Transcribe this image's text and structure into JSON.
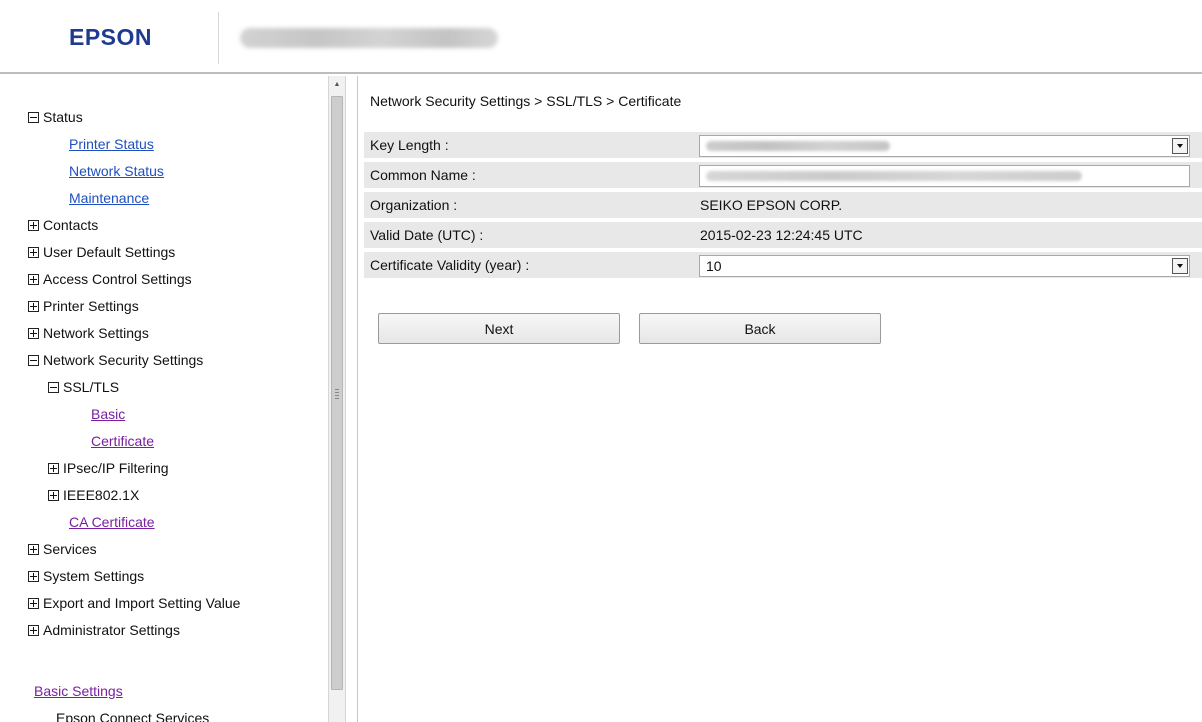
{
  "header": {
    "logo": "EPSON"
  },
  "sidebar": {
    "status": "Status",
    "printer_status": "Printer Status",
    "network_status": "Network Status",
    "maintenance": "Maintenance",
    "contacts": "Contacts",
    "user_default_settings": "User Default Settings",
    "access_control_settings": "Access Control Settings",
    "printer_settings": "Printer Settings",
    "network_settings": "Network Settings",
    "network_security_settings": "Network Security Settings",
    "ssl_tls": "SSL/TLS",
    "basic": "Basic",
    "certificate": "Certificate",
    "ipsec_ip_filtering": "IPsec/IP Filtering",
    "ieee8021x": "IEEE802.1X",
    "ca_certificate": "CA Certificate",
    "services": "Services",
    "system_settings": "System Settings",
    "export_import": "Export and Import Setting Value",
    "administrator_settings": "Administrator Settings",
    "basic_settings": "Basic Settings",
    "epson_connect_services": "Epson Connect Services"
  },
  "main": {
    "breadcrumb": "Network Security Settings > SSL/TLS > Certificate",
    "key_length_label": "Key Length :",
    "common_name_label": "Common Name :",
    "organization_label": "Organization :",
    "organization_value": "SEIKO EPSON CORP.",
    "valid_date_label": "Valid Date (UTC) :",
    "valid_date_value": "2015-02-23 12:24:45 UTC",
    "validity_label": "Certificate Validity (year) :",
    "validity_value": "10",
    "next_button": "Next",
    "back_button": "Back"
  },
  "colors": {
    "logo": "#1f3a8f",
    "link_blue": "#1f4fbf",
    "link_visited": "#7a1fa0",
    "row_bg": "#e8e8e8"
  }
}
